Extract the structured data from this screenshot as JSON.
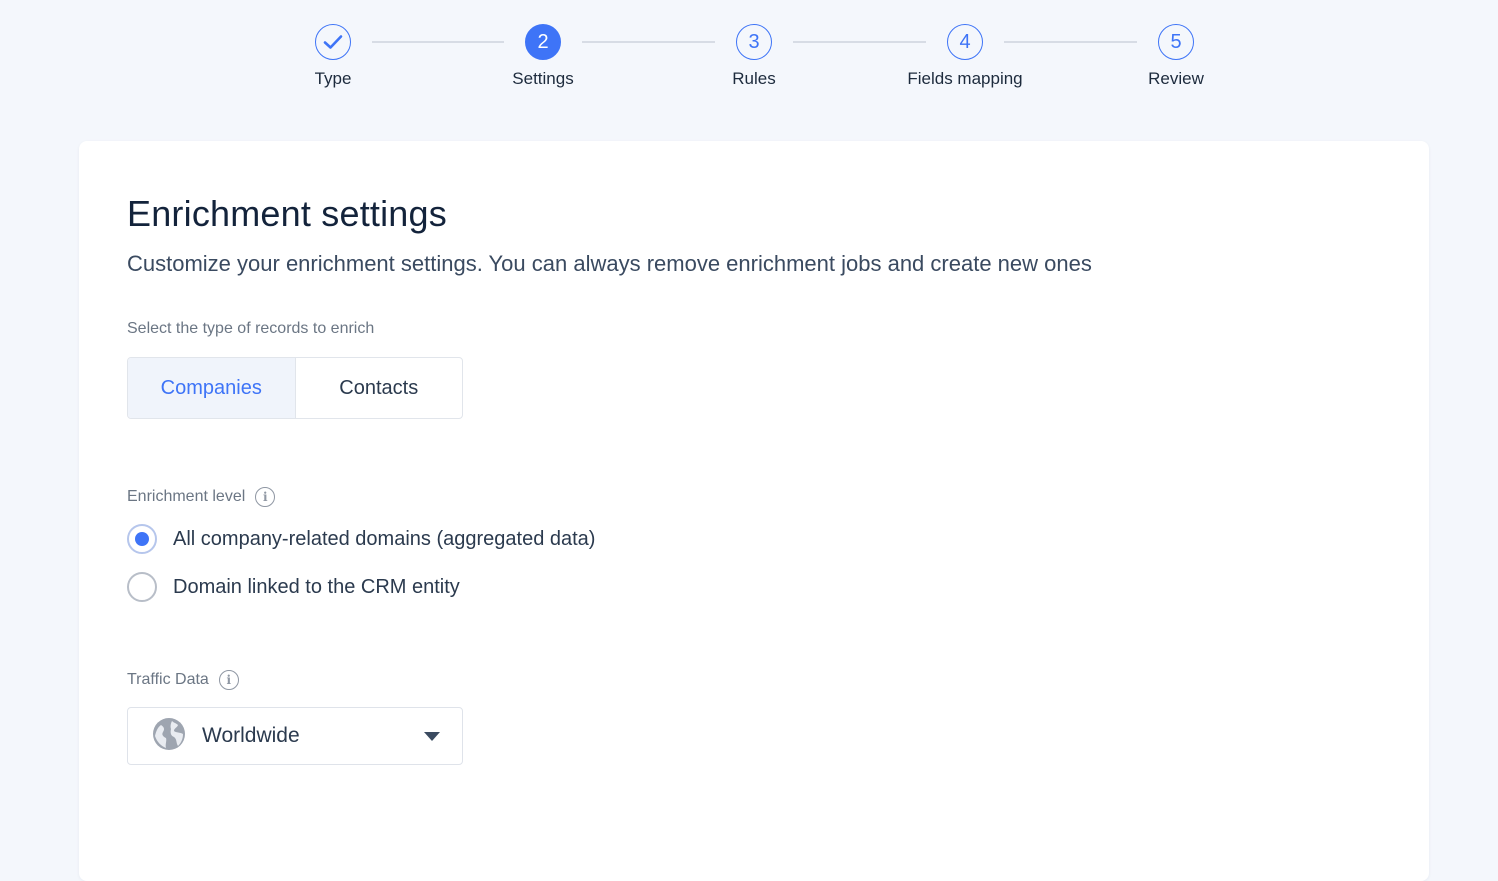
{
  "stepper": {
    "steps": [
      {
        "label": "Type",
        "number": "",
        "status": "completed"
      },
      {
        "label": "Settings",
        "number": "2",
        "status": "active"
      },
      {
        "label": "Rules",
        "number": "3",
        "status": "pending"
      },
      {
        "label": "Fields mapping",
        "number": "4",
        "status": "pending"
      },
      {
        "label": "Review",
        "number": "5",
        "status": "pending"
      }
    ]
  },
  "main": {
    "title": "Enrichment settings",
    "subtitle": "Customize your enrichment settings. You can always remove enrichment jobs and create new ones",
    "record_type": {
      "label": "Select the type of records to enrich",
      "options": [
        "Companies",
        "Contacts"
      ],
      "selected": "Companies"
    },
    "enrichment_level": {
      "label": "Enrichment level",
      "options": [
        {
          "label": "All company-related domains (aggregated data)",
          "checked": true
        },
        {
          "label": "Domain linked to the CRM entity",
          "checked": false
        }
      ]
    },
    "traffic_data": {
      "label": "Traffic Data",
      "value": "Worldwide",
      "icon": "globe-icon"
    }
  },
  "colors": {
    "accent": "#3e74f7",
    "background": "#f4f7fc",
    "card": "#ffffff"
  }
}
